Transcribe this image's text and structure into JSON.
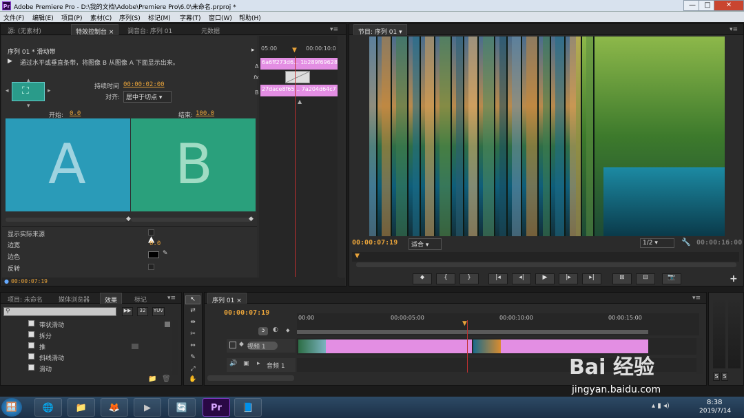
{
  "window": {
    "title": "Adobe Premiere Pro - D:\\我的文档\\Adobe\\Premiere Pro\\6.0\\未命名.prproj *",
    "logo_text": "Pr",
    "min_glyph": "—",
    "max_glyph": "□",
    "close_glyph": "✕"
  },
  "menu": [
    "文件(F)",
    "编辑(E)",
    "项目(P)",
    "素材(C)",
    "序列(S)",
    "标记(M)",
    "字幕(T)",
    "窗口(W)",
    "帮助(H)"
  ],
  "top_left_panel": {
    "tabs": [
      "源: (无素材)",
      "特效控制台",
      "调音台: 序列 01",
      "元数据"
    ],
    "close_x": "×",
    "breadcrumb": "序列 01 * 滑动带",
    "description": "通过水平或垂直条带，将图像 B 从图像 A 下面显示出来。",
    "duration_label": "持续时间",
    "duration_value": "00:00:02:00",
    "align_label": "对齐:",
    "align_value": "居中于切点",
    "start_label": "开始:",
    "start_value": "0.0",
    "end_label": "结束:",
    "end_value": "100.0",
    "preview_a": "A",
    "preview_b": "B",
    "props": [
      {
        "label": "显示实际来源",
        "value": ""
      },
      {
        "label": "边宽",
        "value": "0.0"
      },
      {
        "label": "边色",
        "value": ""
      },
      {
        "label": "反转",
        "value": ""
      }
    ],
    "timecode": "00:00:07:19",
    "mini_timeline": {
      "ruler_start": "05:00",
      "ruler_end": "00:00:10:0",
      "track_a": "A",
      "track_fx": "fx",
      "track_b": "B",
      "clip_a": "6a6ff273d6... 1b289f69628a",
      "clip_b": "27dace8f65... 7a204d64c7"
    }
  },
  "program_monitor": {
    "tab": "节目: 序列 01",
    "timecode": "00:00:07:19",
    "fit": "适合",
    "resolution": "1/2",
    "duration": "00:00:16:00",
    "transport": [
      "⬥",
      "{",
      "}",
      "|◂",
      "◂|",
      "▶",
      "|▸",
      "▸|",
      "⊞",
      "⊟",
      "📷"
    ],
    "add_glyph": "+"
  },
  "project_panel": {
    "tabs": [
      "项目: 未命名",
      "媒体浏览器",
      "效果",
      "标记"
    ],
    "tool_labels": [
      "▶▶",
      "32",
      "YUV"
    ],
    "items": [
      "带状滑动",
      "拆分",
      "推",
      "斜线滑动",
      "滑动"
    ]
  },
  "tools": [
    "↖",
    "⇄",
    "⇹",
    "✂",
    "⇔",
    "✎",
    "⤢",
    "✋",
    "🔍"
  ],
  "timeline": {
    "tab": "序列 01",
    "timecode": "00:00:07:19",
    "ruler": [
      "00:00",
      "00:00:05:00",
      "00:00:10:00",
      "00:00:15:00"
    ],
    "video_track": "视频 1",
    "audio_track": "音频 1",
    "audio_num": "1"
  },
  "meters": {
    "labels": [
      "S",
      "S"
    ]
  },
  "taskbar": {
    "apps": [
      "🪟",
      "🌐",
      "📁",
      "🦊",
      "▶",
      "🔄",
      "Pr",
      "📘"
    ],
    "time": "8:38",
    "date": "2019/7/14"
  },
  "watermark": {
    "text": "Bai 经验",
    "url": "jingyan.baidu.com"
  },
  "colors": {
    "accent_orange": "#e8a33a",
    "clip_pink": "#e38ee3",
    "preview_a": "#2a9bb8",
    "preview_b": "#2aa07c"
  }
}
